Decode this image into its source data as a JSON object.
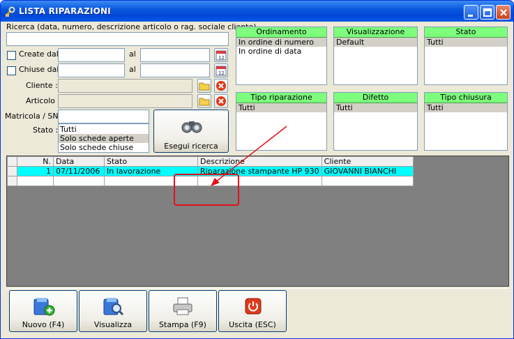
{
  "window": {
    "title": "LISTA RIPARAZIONI",
    "buttons": [
      "minimize",
      "maximize",
      "close"
    ]
  },
  "search": {
    "label": "Ricerca (data, numero, descrizione articolo o rag. sociale cliente)",
    "value": ""
  },
  "filters": {
    "create_dal_label": "Create dal",
    "chiuse_dal_label": "Chiuse dal",
    "al_label": "al",
    "cliente_label": "Cliente :",
    "articolo_label": "Articolo :",
    "matricola_label": "Matricola / SN:",
    "stato_label": "Stato :",
    "stato_options": [
      "Tutti",
      "Solo schede aperte",
      "Solo schede chiuse"
    ],
    "stato_selected": "Solo schede aperte"
  },
  "search_button": {
    "label": "Esegui ricerca"
  },
  "groups": {
    "ordinamento": {
      "title": "Ordinamento",
      "items": [
        "In ordine di numero",
        "In ordine di data"
      ],
      "selected": "In ordine di numero"
    },
    "visualizzazione": {
      "title": "Visualizzazione",
      "items": [
        "Default"
      ],
      "selected": "Default"
    },
    "stato": {
      "title": "Stato",
      "items": [
        "Tutti"
      ],
      "selected": "Tutti"
    },
    "tipo_riparazione": {
      "title": "Tipo riparazione",
      "items": [
        "Tutti"
      ],
      "selected": "Tutti"
    },
    "difetto": {
      "title": "Difetto",
      "items": [
        "Tutti"
      ],
      "selected": "Tutti"
    },
    "tipo_chiusura": {
      "title": "Tipo chiusura",
      "items": [
        "Tutti"
      ],
      "selected": "Tutti"
    }
  },
  "table": {
    "columns": [
      "N.",
      "Data",
      "Stato",
      "Descrizione",
      "Cliente"
    ],
    "rows": [
      [
        "1",
        "07/11/2006",
        "In lavorazione",
        "Riparazione stampante HP 930",
        "GIOVANNI BIANCHI"
      ]
    ]
  },
  "actions": {
    "nuovo": "Nuovo (F4)",
    "visualizza": "Visualizza",
    "stampa": "Stampa (F9)",
    "uscita": "Uscita (ESC)"
  },
  "colors": {
    "group_header": "#7dff7d",
    "selected_row": "#00ffff",
    "annotation": "#e0101a",
    "titlebar": "#0a58e0"
  }
}
